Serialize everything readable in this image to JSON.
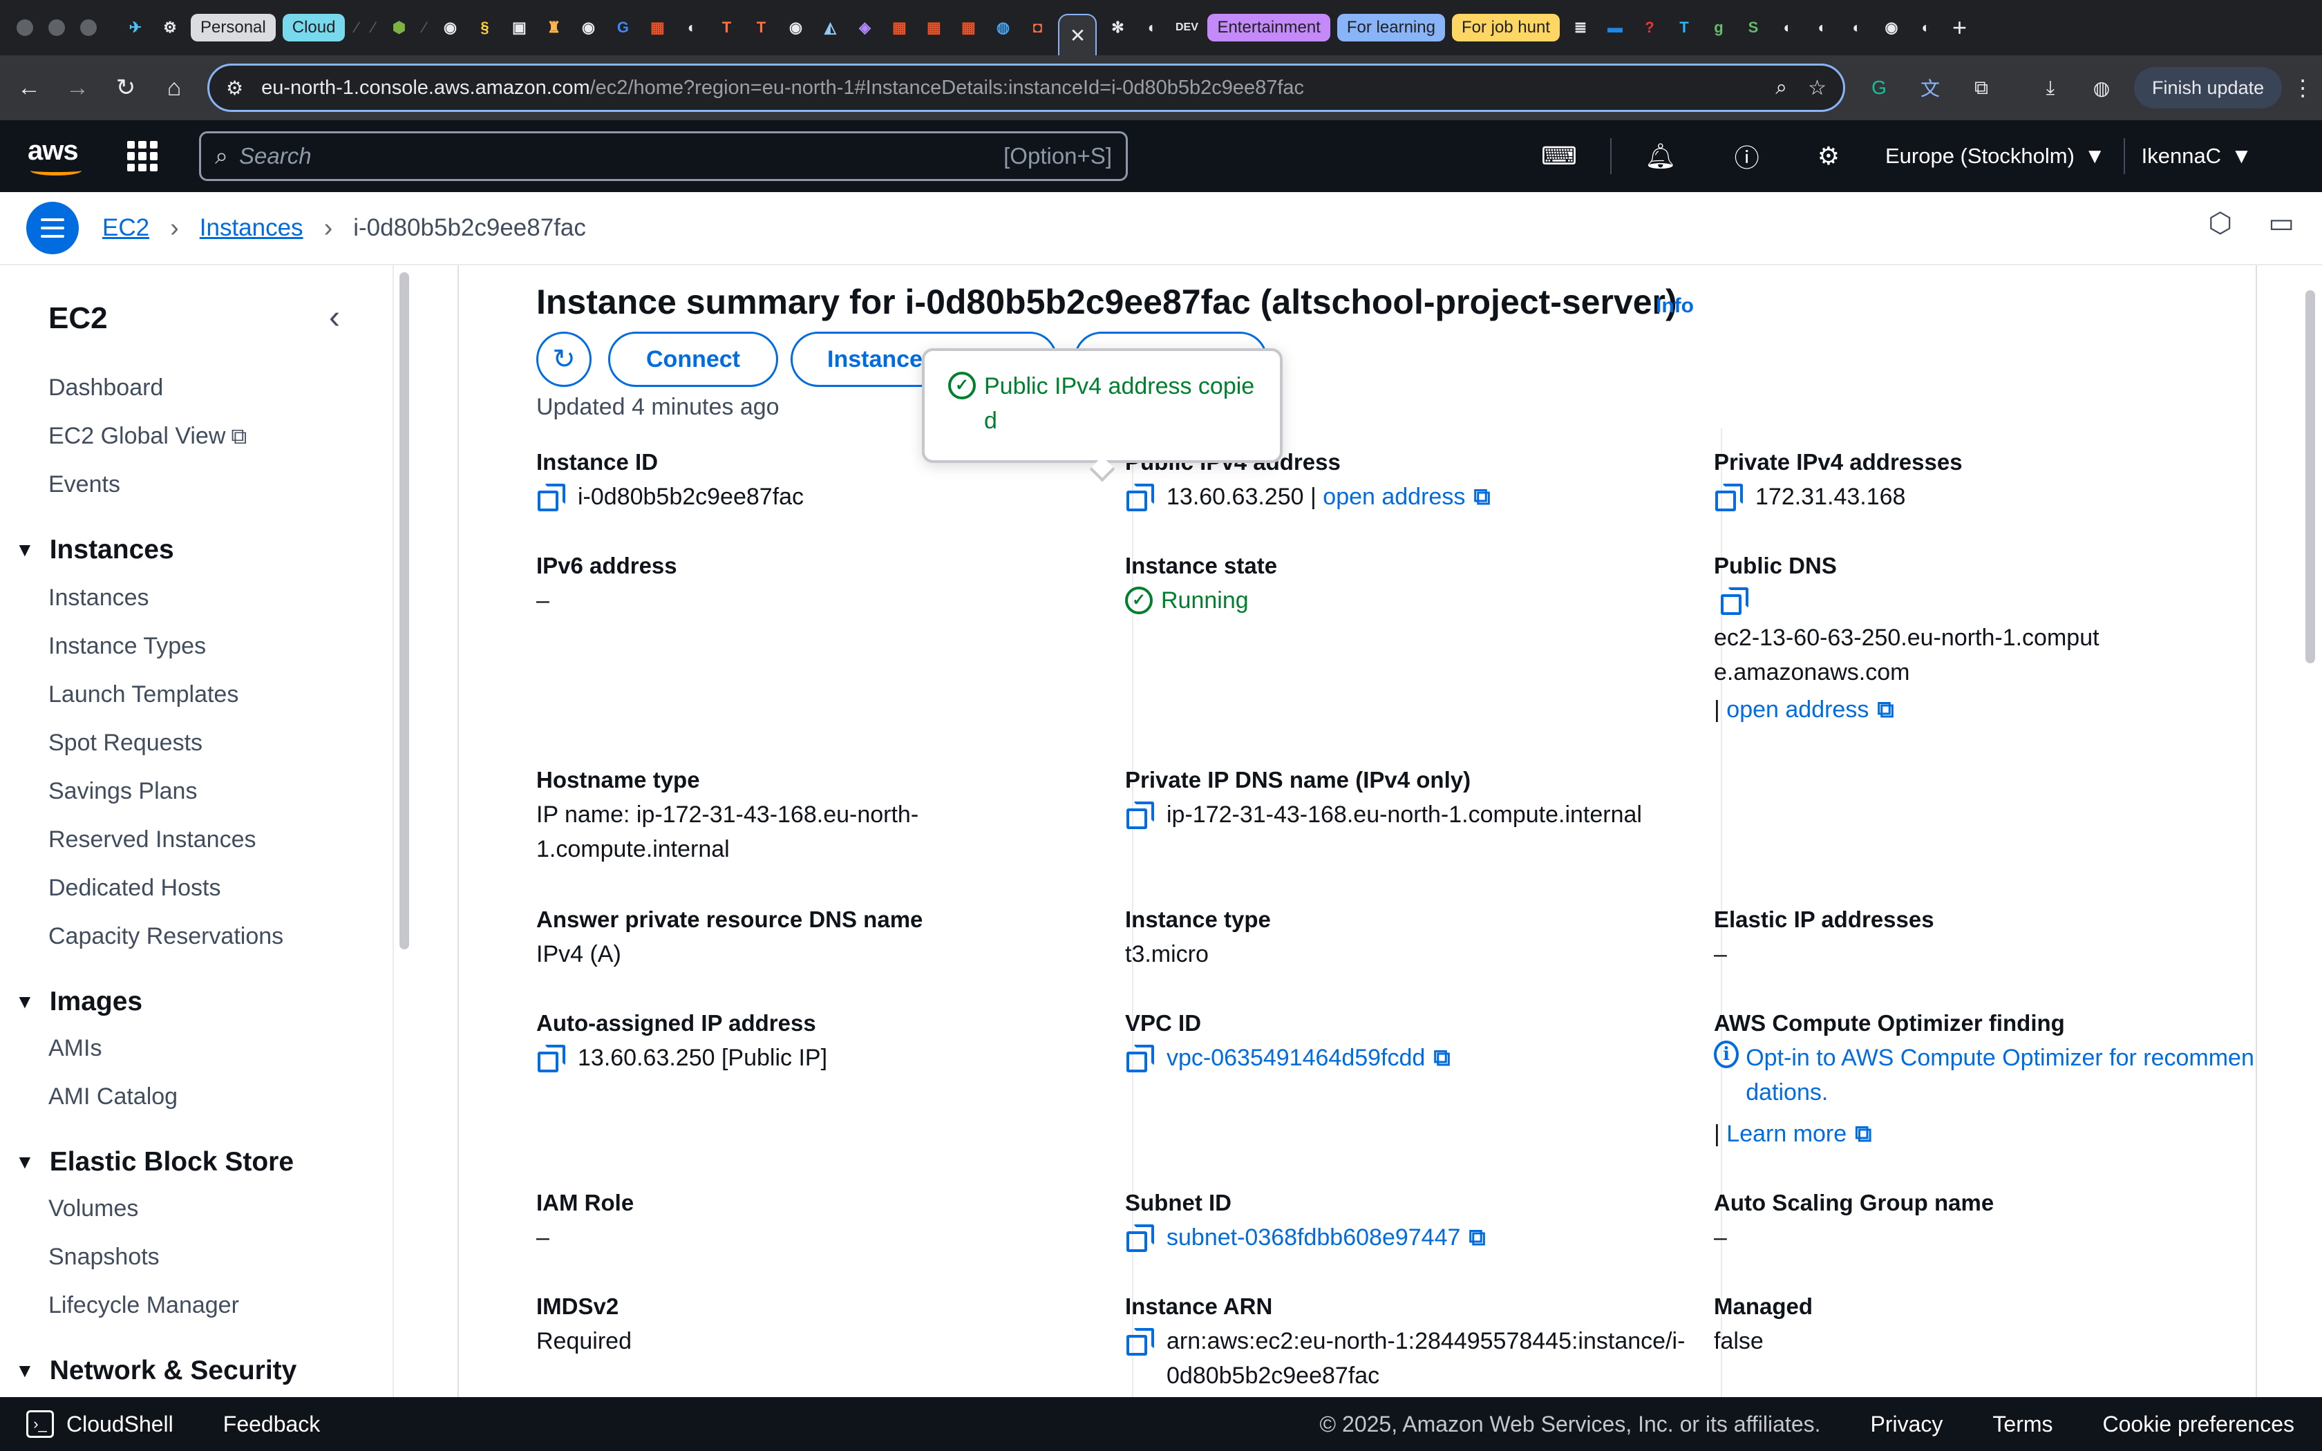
{
  "browser": {
    "tab_groups": [
      {
        "label": "Personal",
        "bg": "#dadce0",
        "fg": "#202124"
      },
      {
        "label": "Cloud",
        "bg": "#78d9ec",
        "fg": "#202124"
      },
      {
        "label": "Entertainment",
        "bg": "#c58af9",
        "fg": "#202124"
      },
      {
        "label": "For learning",
        "bg": "#8ab4f8",
        "fg": "#202124"
      },
      {
        "label": "For job hunt",
        "bg": "#fdd663",
        "fg": "#202124"
      }
    ],
    "url_host": "eu-north-1.console.aws.amazon.com",
    "url_path": "/ec2/home?region=eu-north-1#InstanceDetails:instanceId=i-0d80b5b2c9ee87fac",
    "finish_update_label": "Finish update"
  },
  "aws_nav": {
    "logo_text": "aws",
    "search_placeholder": "Search",
    "search_shortcut": "[Option+S]",
    "region": "Europe (Stockholm)",
    "user": "IkennaC"
  },
  "breadcrumb": {
    "items": [
      "EC2",
      "Instances"
    ],
    "current": "i-0d80b5b2c9ee87fac"
  },
  "sidenav": {
    "title": "EC2",
    "top_items": [
      "Dashboard",
      "EC2 Global View",
      "Events"
    ],
    "sections": [
      {
        "title": "Instances",
        "items": [
          "Instances",
          "Instance Types",
          "Launch Templates",
          "Spot Requests",
          "Savings Plans",
          "Reserved Instances",
          "Dedicated Hosts",
          "Capacity Reservations"
        ]
      },
      {
        "title": "Images",
        "items": [
          "AMIs",
          "AMI Catalog"
        ]
      },
      {
        "title": "Elastic Block Store",
        "items": [
          "Volumes",
          "Snapshots",
          "Lifecycle Manager"
        ]
      },
      {
        "title": "Network & Security",
        "items": []
      }
    ]
  },
  "summary": {
    "title": "Instance summary for i-0d80b5b2c9ee87fac (altschool-project-server)",
    "info_label": "Info",
    "connect_label": "Connect",
    "instance_state_label": "Instance state",
    "updated": "Updated 4 minutes ago",
    "popover": "Public IPv4 address copied"
  },
  "fields": {
    "instance_id": {
      "label": "Instance ID",
      "value": "i-0d80b5b2c9ee87fac"
    },
    "public_ipv4": {
      "label": "Public IPv4 address",
      "value": "13.60.63.250",
      "sep": "|",
      "link": "open address"
    },
    "private_ipv4": {
      "label": "Private IPv4 addresses",
      "value": "172.31.43.168"
    },
    "ipv6": {
      "label": "IPv6 address",
      "value": "–"
    },
    "instance_state": {
      "label": "Instance state",
      "value": "Running"
    },
    "public_dns": {
      "label": "Public DNS",
      "value": "ec2-13-60-63-250.eu-north-1.compute.amazonaws.com",
      "sep": "|",
      "link": "open address"
    },
    "hostname_type": {
      "label": "Hostname type",
      "value": "IP name: ip-172-31-43-168.eu-north-1.compute.internal"
    },
    "private_ip_dns": {
      "label": "Private IP DNS name (IPv4 only)",
      "value": "ip-172-31-43-168.eu-north-1.compute.internal"
    },
    "answer_dns": {
      "label": "Answer private resource DNS name",
      "value": "IPv4 (A)"
    },
    "instance_type": {
      "label": "Instance type",
      "value": "t3.micro"
    },
    "elastic_ip": {
      "label": "Elastic IP addresses",
      "value": "–"
    },
    "auto_ip": {
      "label": "Auto-assigned IP address",
      "value": "13.60.63.250 [Public IP]"
    },
    "vpc_id": {
      "label": "VPC ID",
      "value": "vpc-0635491464d59fcdd"
    },
    "optimizer": {
      "label": "AWS Compute Optimizer finding",
      "value": "Opt-in to AWS Compute Optimizer for recommendations.",
      "sep": "|",
      "link": "Learn more"
    },
    "iam_role": {
      "label": "IAM Role",
      "value": "–"
    },
    "subnet_id": {
      "label": "Subnet ID",
      "value": "subnet-0368fdbb608e97447"
    },
    "asg_name": {
      "label": "Auto Scaling Group name",
      "value": "–"
    },
    "imdsv2": {
      "label": "IMDSv2",
      "value": "Required"
    },
    "instance_arn": {
      "label": "Instance ARN",
      "value": "arn:aws:ec2:eu-north-1:284495578445:instance/i-0d80b5b2c9ee87fac"
    },
    "managed": {
      "label": "Managed",
      "value": "false"
    }
  },
  "footer": {
    "cloudshell": "CloudShell",
    "feedback": "Feedback",
    "copyright": "© 2025, Amazon Web Services, Inc. or its affiliates.",
    "privacy": "Privacy",
    "terms": "Terms",
    "cookies": "Cookie preferences"
  },
  "colors": {
    "link": "#006ce0",
    "success": "#00802f",
    "nav_bg": "#0f141a",
    "logo_accent": "#ff9900"
  }
}
